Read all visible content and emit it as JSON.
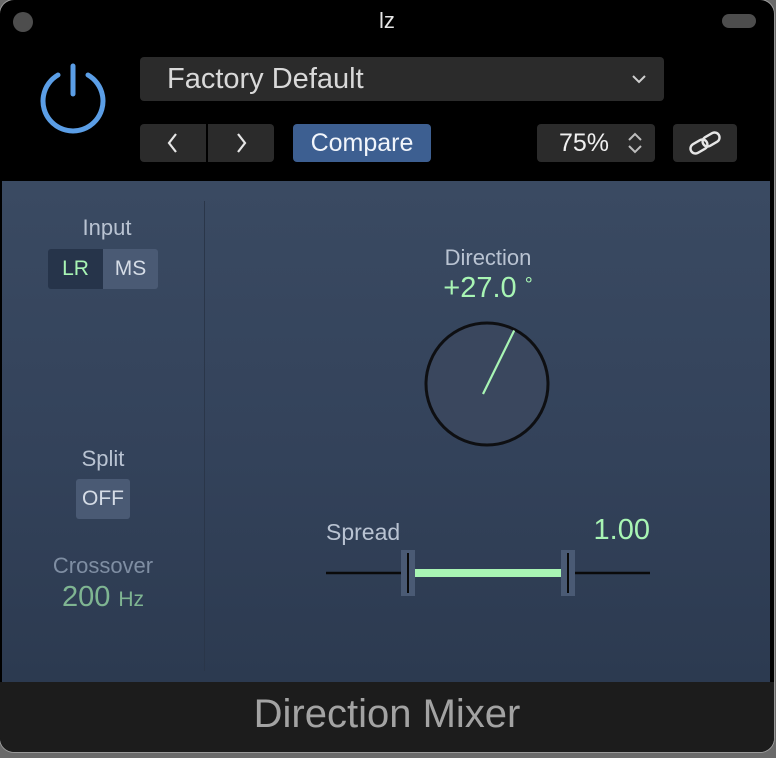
{
  "window": {
    "title": "lz"
  },
  "header": {
    "preset_name": "Factory Default",
    "compare_label": "Compare",
    "zoom_value": "75%"
  },
  "input": {
    "label": "Input",
    "options": [
      "LR",
      "MS"
    ],
    "selected": "LR"
  },
  "split": {
    "label": "Split",
    "value": "OFF"
  },
  "crossover": {
    "label": "Crossover",
    "value": "200",
    "unit": "Hz"
  },
  "direction": {
    "label": "Direction",
    "value_text": "+27.0",
    "unit": "°",
    "degrees": 27.0
  },
  "spread": {
    "label": "Spread",
    "value_text": "1.00",
    "value": 1.0
  },
  "footer": {
    "title": "Direction Mixer"
  },
  "colors": {
    "accent_green": "#a8f5b4",
    "compare_blue": "#3d5f91",
    "power_blue": "#5b9ee6",
    "panel_blue": "#3a4a62"
  },
  "icons": {
    "power": "power-icon",
    "preset_menu": "chevron-down-icon",
    "prev": "chevron-left-icon",
    "next": "chevron-right-icon",
    "zoom_stepper": "stepper-icon",
    "link": "link-icon"
  }
}
